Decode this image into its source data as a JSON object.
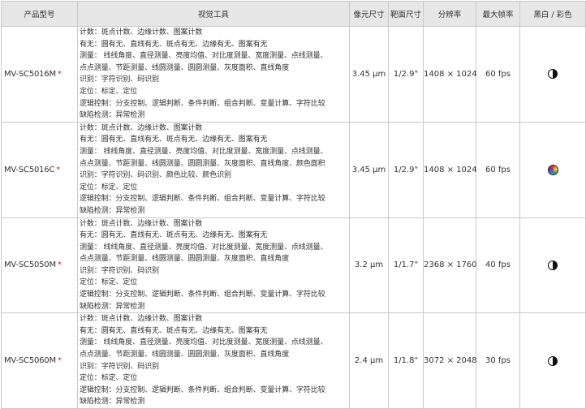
{
  "headers": {
    "model": "产品型号",
    "tools": "视觉工具",
    "pixel": "像元尺寸",
    "target": "靶面尺寸",
    "resolution": "分辨率",
    "fps": "最大帧率",
    "color": "黑白 / 彩色"
  },
  "colors": {
    "star": "#d9231d",
    "header_bg": "#e7e7e7",
    "border": "#c9c9c9"
  },
  "rows": [
    {
      "model": "MV-SC5016M",
      "star": "*",
      "tools": [
        "计数：斑点计数、边缘计数、图案计数",
        "有无：圆有无、直线有无、斑点有无、边缘有无、图案有无",
        "测量：  线线角度、直径测量、亮度均值、对比度测量、宽度测量、点线测量、",
        "点点测量、节距测量、线圆测量、圆圆测量、灰度面积、直线角度",
        "识别：字符识别、码识别",
        "定位：标定、定位",
        "逻辑控制：分支控制、逻辑判断、条件判断、组合判断、变量计算、字符比较",
        "缺陷检测：异常检测"
      ],
      "pixel": "3.45 μm",
      "target": "1/2.9\"",
      "resolution": "1408 × 1024",
      "fps": "60 fps",
      "color_icon": "bw-icon"
    },
    {
      "model": "MV-SC5016C",
      "star": "*",
      "tools": [
        "计数：斑点计数、边缘计数、图案计数",
        "有无：圆有无、直线有无、斑点有无、边缘有无、图案有无",
        "测量：  线线角度、直径测量、亮度均值、对比度测量、宽度测量、点线测量、",
        "点点测量、节距测量、线圆测量、圆圆测量、灰度面积、直线角度、颜色面积",
        "识别：字符识别、码识别、颜色比较、颜色识别",
        "定位：标定、定位",
        "逻辑控制：分支控制、逻辑判断、条件判断、组合判断、变量计算、字符比较",
        "缺陷检测：异常检测"
      ],
      "pixel": "3.45 μm",
      "target": "1/2.9\"",
      "resolution": "1408 × 1024",
      "fps": "60 fps",
      "color_icon": "color-icon"
    },
    {
      "model": "MV-SC5050M",
      "star": "*",
      "tools": [
        "计数：斑点计数、边缘计数、图案计数",
        "有无：圆有无、直线有无、斑点有无、边缘有无、图案有无",
        "测量：  线线角度、直径测量、亮度均值、对比度测量、宽度测量、点线测量、",
        "点点测量、节距测量、线圆测量、圆圆测量、灰度面积、直线角度",
        "识别：字符识别、码识别",
        "定位：标定、定位",
        "逻辑控制：分支控制、逻辑判断、条件判断、组合判断、变量计算、字符比较",
        "缺陷检测：异常检测"
      ],
      "pixel": "3.2 μm",
      "target": "1/1.7\"",
      "resolution": "2368 × 1760",
      "fps": "40 fps",
      "color_icon": "bw-icon"
    },
    {
      "model": "MV-SC5060M",
      "star": "*",
      "tools": [
        "计数：斑点计数、边缘计数、图案计数",
        "有无：圆有无、直线有无、斑点有无、边缘有无、图案有无",
        "测量：  线线角度、直径测量、亮度均值、对比度测量、宽度测量、点线测量、",
        "点点测量、节距测量、线圆测量、圆圆测量、灰度面积、直线角度",
        "识别：字符识别、码识别",
        "定位：标定、定位",
        "逻辑控制：分支控制、逻辑判断、条件判断、组合判断、变量计算、字符比较",
        "缺陷检测：异常检测"
      ],
      "pixel": "2.4 μm",
      "target": "1/1.8\"",
      "resolution": "3072 × 2048",
      "fps": "30 fps",
      "color_icon": "bw-icon"
    }
  ]
}
